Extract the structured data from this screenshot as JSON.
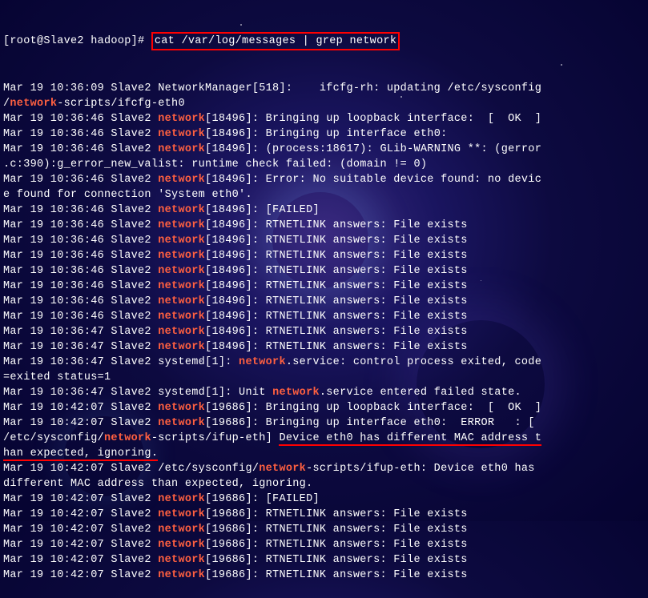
{
  "prompt": {
    "user_host": "[root@Slave2 hadoop]# ",
    "command": "cat /var/log/messages | grep network"
  },
  "lines": [
    {
      "segs": [
        {
          "t": "Mar 19 10:36:09 Slave2 NetworkManager[518]:    ifcfg-rh: updating /etc/sysconfig"
        }
      ]
    },
    {
      "segs": [
        {
          "t": "/"
        },
        {
          "t": "network",
          "c": "orange"
        },
        {
          "t": "-scripts/ifcfg-eth0"
        }
      ]
    },
    {
      "segs": [
        {
          "t": "Mar 19 10:36:46 Slave2 "
        },
        {
          "t": "network",
          "c": "orange"
        },
        {
          "t": "[18496]: Bringing up loopback interface:  [  OK  ]"
        }
      ]
    },
    {
      "segs": [
        {
          "t": "Mar 19 10:36:46 Slave2 "
        },
        {
          "t": "network",
          "c": "orange"
        },
        {
          "t": "[18496]: Bringing up interface eth0:"
        }
      ]
    },
    {
      "segs": [
        {
          "t": "Mar 19 10:36:46 Slave2 "
        },
        {
          "t": "network",
          "c": "orange"
        },
        {
          "t": "[18496]: (process:18617): GLib-WARNING **: (gerror"
        }
      ]
    },
    {
      "segs": [
        {
          "t": ".c:390):g_error_new_valist: runtime check failed: (domain != 0)"
        }
      ]
    },
    {
      "segs": [
        {
          "t": "Mar 19 10:36:46 Slave2 "
        },
        {
          "t": "network",
          "c": "orange"
        },
        {
          "t": "[18496]: Error: No suitable device found: no devic"
        }
      ]
    },
    {
      "segs": [
        {
          "t": "e found for connection 'System eth0'."
        }
      ]
    },
    {
      "segs": [
        {
          "t": "Mar 19 10:36:46 Slave2 "
        },
        {
          "t": "network",
          "c": "orange"
        },
        {
          "t": "[18496]: [FAILED]"
        }
      ]
    },
    {
      "segs": [
        {
          "t": "Mar 19 10:36:46 Slave2 "
        },
        {
          "t": "network",
          "c": "orange"
        },
        {
          "t": "[18496]: RTNETLINK answers: File exists"
        }
      ]
    },
    {
      "segs": [
        {
          "t": "Mar 19 10:36:46 Slave2 "
        },
        {
          "t": "network",
          "c": "orange"
        },
        {
          "t": "[18496]: RTNETLINK answers: File exists"
        }
      ]
    },
    {
      "segs": [
        {
          "t": "Mar 19 10:36:46 Slave2 "
        },
        {
          "t": "network",
          "c": "orange"
        },
        {
          "t": "[18496]: RTNETLINK answers: File exists"
        }
      ]
    },
    {
      "segs": [
        {
          "t": "Mar 19 10:36:46 Slave2 "
        },
        {
          "t": "network",
          "c": "orange"
        },
        {
          "t": "[18496]: RTNETLINK answers: File exists"
        }
      ]
    },
    {
      "segs": [
        {
          "t": "Mar 19 10:36:46 Slave2 "
        },
        {
          "t": "network",
          "c": "orange"
        },
        {
          "t": "[18496]: RTNETLINK answers: File exists"
        }
      ]
    },
    {
      "segs": [
        {
          "t": "Mar 19 10:36:46 Slave2 "
        },
        {
          "t": "network",
          "c": "orange"
        },
        {
          "t": "[18496]: RTNETLINK answers: File exists"
        }
      ]
    },
    {
      "segs": [
        {
          "t": "Mar 19 10:36:46 Slave2 "
        },
        {
          "t": "network",
          "c": "orange"
        },
        {
          "t": "[18496]: RTNETLINK answers: File exists"
        }
      ]
    },
    {
      "segs": [
        {
          "t": "Mar 19 10:36:47 Slave2 "
        },
        {
          "t": "network",
          "c": "orange"
        },
        {
          "t": "[18496]: RTNETLINK answers: File exists"
        }
      ]
    },
    {
      "segs": [
        {
          "t": "Mar 19 10:36:47 Slave2 "
        },
        {
          "t": "network",
          "c": "orange"
        },
        {
          "t": "[18496]: RTNETLINK answers: File exists"
        }
      ]
    },
    {
      "segs": [
        {
          "t": "Mar 19 10:36:47 Slave2 systemd[1]: "
        },
        {
          "t": "network",
          "c": "orange"
        },
        {
          "t": ".service: control process exited, code"
        }
      ]
    },
    {
      "segs": [
        {
          "t": "=exited status=1"
        }
      ]
    },
    {
      "segs": [
        {
          "t": "Mar 19 10:36:47 Slave2 systemd[1]: Unit "
        },
        {
          "t": "network",
          "c": "orange"
        },
        {
          "t": ".service entered failed state."
        }
      ]
    },
    {
      "segs": [
        {
          "t": "Mar 19 10:42:07 Slave2 "
        },
        {
          "t": "network",
          "c": "orange"
        },
        {
          "t": "[19686]: Bringing up loopback interface:  [  OK  ]"
        }
      ]
    },
    {
      "segs": [
        {
          "t": "Mar 19 10:42:07 Slave2 "
        },
        {
          "t": "network",
          "c": "orange"
        },
        {
          "t": "[19686]: Bringing up interface eth0:  ERROR   : ["
        }
      ]
    },
    {
      "segs": [
        {
          "t": "/etc/sysconfig/"
        },
        {
          "t": "network",
          "c": "orange"
        },
        {
          "t": "-scripts/ifup-eth] "
        },
        {
          "t": "Device eth0 has different MAC address t",
          "u": true
        }
      ]
    },
    {
      "segs": [
        {
          "t": "han expected, ignoring.",
          "u": true
        }
      ]
    },
    {
      "segs": [
        {
          "t": "Mar 19 10:42:07 Slave2 /etc/sysconfig/"
        },
        {
          "t": "network",
          "c": "orange"
        },
        {
          "t": "-scripts/ifup-eth: Device eth0 has "
        }
      ]
    },
    {
      "segs": [
        {
          "t": "different MAC address than expected, ignoring."
        }
      ]
    },
    {
      "segs": [
        {
          "t": "Mar 19 10:42:07 Slave2 "
        },
        {
          "t": "network",
          "c": "orange"
        },
        {
          "t": "[19686]: [FAILED]"
        }
      ]
    },
    {
      "segs": [
        {
          "t": "Mar 19 10:42:07 Slave2 "
        },
        {
          "t": "network",
          "c": "orange"
        },
        {
          "t": "[19686]: RTNETLINK answers: File exists"
        }
      ]
    },
    {
      "segs": [
        {
          "t": "Mar 19 10:42:07 Slave2 "
        },
        {
          "t": "network",
          "c": "orange"
        },
        {
          "t": "[19686]: RTNETLINK answers: File exists"
        }
      ]
    },
    {
      "segs": [
        {
          "t": "Mar 19 10:42:07 Slave2 "
        },
        {
          "t": "network",
          "c": "orange"
        },
        {
          "t": "[19686]: RTNETLINK answers: File exists"
        }
      ]
    },
    {
      "segs": [
        {
          "t": "Mar 19 10:42:07 Slave2 "
        },
        {
          "t": "network",
          "c": "orange"
        },
        {
          "t": "[19686]: RTNETLINK answers: File exists"
        }
      ]
    },
    {
      "segs": [
        {
          "t": "Mar 19 10:42:07 Slave2 "
        },
        {
          "t": "network",
          "c": "orange"
        },
        {
          "t": "[19686]: RTNETLINK answers: File exists"
        }
      ]
    }
  ]
}
